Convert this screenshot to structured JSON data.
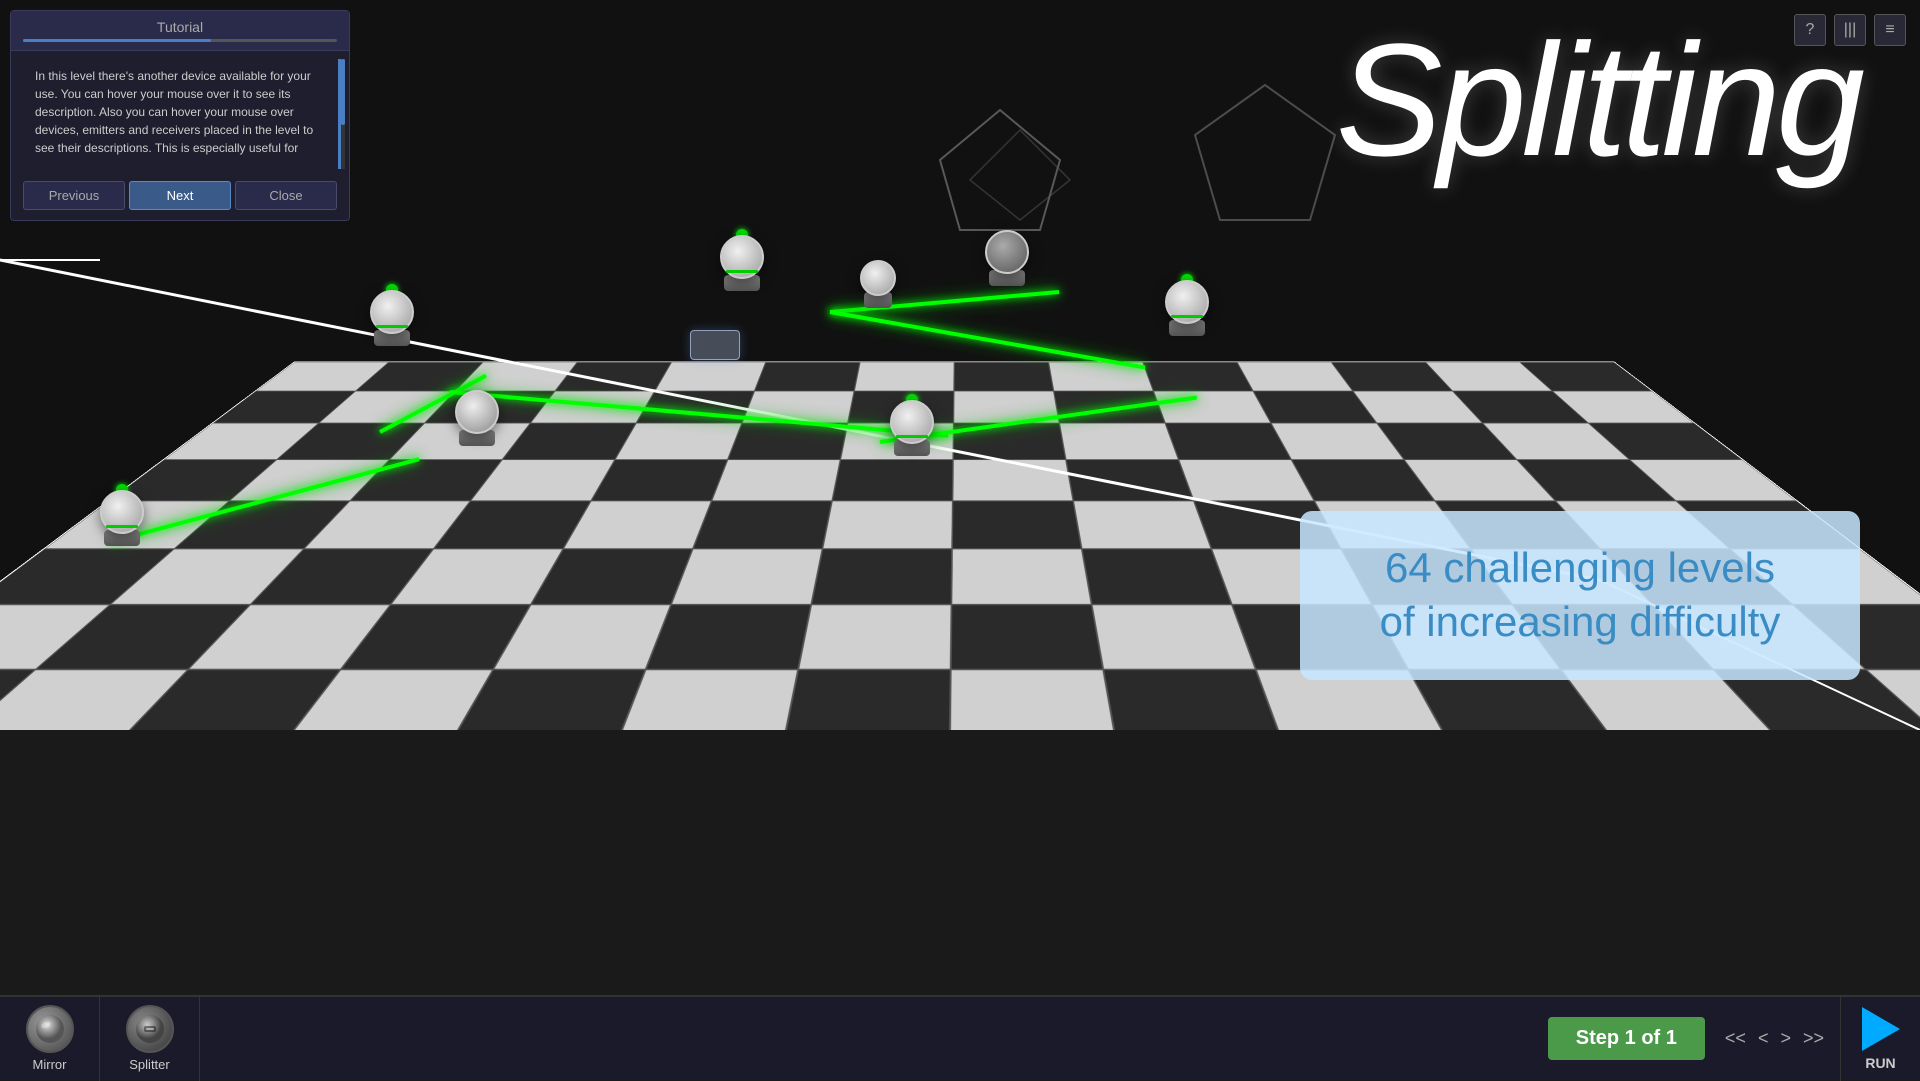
{
  "title": "Splitting",
  "tutorial": {
    "title": "Tutorial",
    "body_text": "In this level there's another device available for your use. You can hover your mouse over it to see its description. Also you can hover your mouse over devices, emitters and receivers placed in the level to see their descriptions. This is especially useful for",
    "buttons": {
      "previous": "Previous",
      "next": "Next",
      "close": "Close"
    },
    "progress_percent": 60
  },
  "promo": {
    "line1": "64 challenging levels",
    "line2": "of increasing difficulty"
  },
  "toolbar": {
    "tools": [
      {
        "label": "Mirror"
      },
      {
        "label": "Splitter"
      }
    ],
    "step_label": "Step 1 of 1",
    "run_label": "RUN"
  },
  "nav": {
    "arrows": [
      "<",
      "<",
      ">",
      ">"
    ]
  },
  "top_icons": [
    "?",
    "|||",
    "≡"
  ]
}
